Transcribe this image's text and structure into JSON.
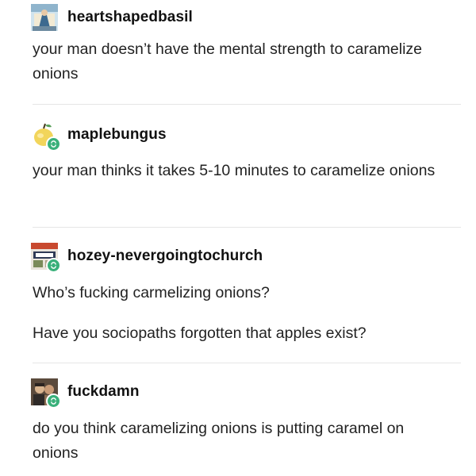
{
  "posts": [
    {
      "username": "heartshapedbasil",
      "avatar_icon": "blue-illustration-avatar-icon",
      "reblog_badge": false,
      "paragraphs": [
        "your man doesn’t have the mental strength to caramelize onions"
      ]
    },
    {
      "username": "maplebungus",
      "avatar_icon": "yellow-fruit-avatar-icon",
      "reblog_badge": true,
      "paragraphs": [
        "your man thinks it takes 5-10 minutes to caramelize onions"
      ]
    },
    {
      "username": "hozey-nevergoingtochurch",
      "avatar_icon": "album-cover-avatar-icon",
      "reblog_badge": true,
      "paragraphs": [
        "Who’s fucking carmelizing onions?",
        "Have you sociopaths forgotten that apples exist?"
      ]
    },
    {
      "username": "fuckdamn",
      "avatar_icon": "photo-avatar-icon",
      "reblog_badge": true,
      "paragraphs": [
        "do you think caramelizing onions is putting caramel on onions"
      ]
    }
  ],
  "colors": {
    "reblog_badge": "#39b07a",
    "divider": "#e6e6e6",
    "text": "#222222"
  }
}
